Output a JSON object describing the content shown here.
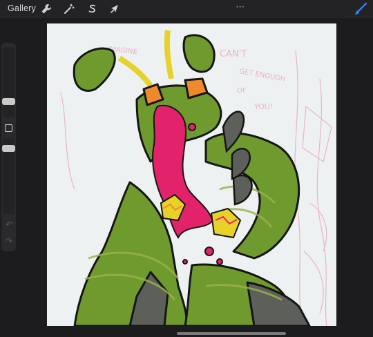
{
  "topbar": {
    "gallery_label": "Gallery",
    "tools": [
      {
        "name": "actions",
        "icon": "wrench-icon"
      },
      {
        "name": "adjustments",
        "icon": "magic-wand-icon"
      },
      {
        "name": "selection",
        "icon": "selection-s-icon"
      },
      {
        "name": "transform",
        "icon": "arrow-cursor-icon"
      }
    ],
    "brush_icon": "brush-icon",
    "accent_color": "#2f7ff7"
  },
  "sidebar": {
    "brush_size_icon": "brush-size-slider",
    "modify_icon": "square-modify-icon",
    "opacity_icon": "opacity-slider",
    "undo_icon": "undo-arrow-icon",
    "redo_icon": "redo-arrow-icon"
  },
  "canvas": {
    "sketch_text": [
      "IMAGINE",
      "CAN'T",
      "GET ENOUGH",
      "OF",
      "YOU!"
    ],
    "colors": {
      "body_green": "#6f9a2e",
      "dark_green": "#4f7523",
      "magenta": "#e2236b",
      "yellow": "#e8d22a",
      "orange": "#ef8a2c",
      "sketch_pink": "#e9a9bf",
      "gray": "#5d605a"
    }
  }
}
